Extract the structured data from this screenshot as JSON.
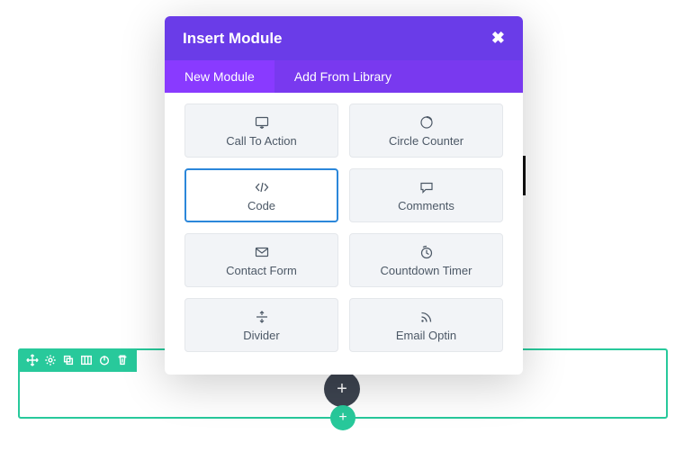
{
  "modal": {
    "title": "Insert Module",
    "close_glyph": "✖",
    "tabs": [
      {
        "label": "New Module",
        "active": true
      },
      {
        "label": "Add From Library",
        "active": false
      }
    ]
  },
  "modules": [
    {
      "id": "call-to-action",
      "label": "Call To Action",
      "icon": "cta",
      "selected": false
    },
    {
      "id": "circle-counter",
      "label": "Circle Counter",
      "icon": "circle-counter",
      "selected": false
    },
    {
      "id": "code",
      "label": "Code",
      "icon": "code",
      "selected": true
    },
    {
      "id": "comments",
      "label": "Comments",
      "icon": "comments",
      "selected": false
    },
    {
      "id": "contact-form",
      "label": "Contact Form",
      "icon": "envelope",
      "selected": false
    },
    {
      "id": "countdown-timer",
      "label": "Countdown Timer",
      "icon": "timer",
      "selected": false
    },
    {
      "id": "divider",
      "label": "Divider",
      "icon": "divider",
      "selected": false
    },
    {
      "id": "email-optin",
      "label": "Email Optin",
      "icon": "rss",
      "selected": false
    }
  ],
  "toolbar": {
    "add_dark_glyph": "+",
    "add_green_glyph": "+"
  },
  "colors": {
    "accent_green": "#28c99b",
    "modal_purple": "#6a3ce8",
    "tab_bg": "#7939ef",
    "tab_active": "#893aff",
    "card_bg": "#f2f4f7",
    "card_border": "#e4e7eb",
    "selected_border": "#2b87da"
  }
}
